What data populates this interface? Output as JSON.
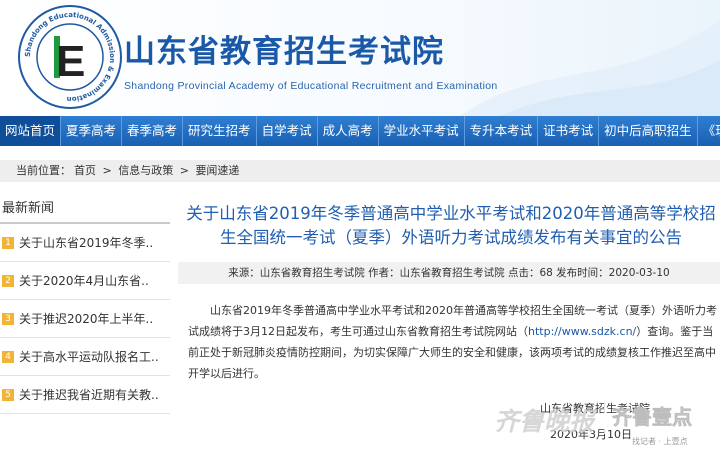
{
  "header": {
    "title": "山东省教育招生考试院",
    "subtitle": "Shandong Provincial Academy of Educational Recruitment and Examination",
    "logo_ring_text": "Shandong Educational Admission & Examination",
    "logo_letter": "E",
    "brand_color": "#1a58a8"
  },
  "nav": {
    "items": [
      {
        "label": "网站首页"
      },
      {
        "label": "夏季高考"
      },
      {
        "label": "春季高考"
      },
      {
        "label": "研究生招考"
      },
      {
        "label": "自学考试"
      },
      {
        "label": "成人高考"
      },
      {
        "label": "学业水平考试"
      },
      {
        "label": "专升本考试"
      },
      {
        "label": "证书考试"
      },
      {
        "label": "初中后高职招生"
      },
      {
        "label": "《现代教育》"
      }
    ],
    "bar_color": "#1a5fb2"
  },
  "breadcrumb": {
    "prefix": "当前位置：",
    "items": [
      "首页",
      "信息与政策",
      "要闻速递"
    ],
    "separator": ">"
  },
  "sidebar": {
    "title": "最新新闻",
    "items": [
      {
        "num": "1",
        "text": "关于山东省2019年冬季.."
      },
      {
        "num": "2",
        "text": "关于2020年4月山东省.."
      },
      {
        "num": "3",
        "text": "关于推迟2020年上半年.."
      },
      {
        "num": "4",
        "text": "关于高水平运动队报名工.."
      },
      {
        "num": "5",
        "text": "关于推迟我省近期有关教.."
      }
    ]
  },
  "article": {
    "title": "关于山东省2019年冬季普通高中学业水平考试和2020年普通高等学校招生全国统一考试（夏季）外语听力考试成绩发布有关事宜的公告",
    "meta": "来源：山东省教育招生考试院 作者：山东省教育招生考试院 点击：68 发布时间：2020-03-10",
    "body_before_url": "山东省2019年冬季普通高中学业水平考试和2020年普通高等学校招生全国统一考试（夏季）外语听力考试成绩将于3月12日起发布，考生可通过山东省教育招生考试院网站（",
    "url": "http://www.sdzk.cn/",
    "body_after_url": "）查询。鉴于当前正处于新冠肺炎疫情防控期间，为切实保障广大师生的安全和健康，该两项考试的成绩复核工作推迟至高中开学以后进行。",
    "sign_org": "山东省教育招生考试院",
    "sign_date": "2020年3月10日"
  },
  "watermark": {
    "text_main": "齐鲁晚报",
    "text_app": "齐鲁壹点",
    "text_small": "找记者 · 上壹点"
  }
}
